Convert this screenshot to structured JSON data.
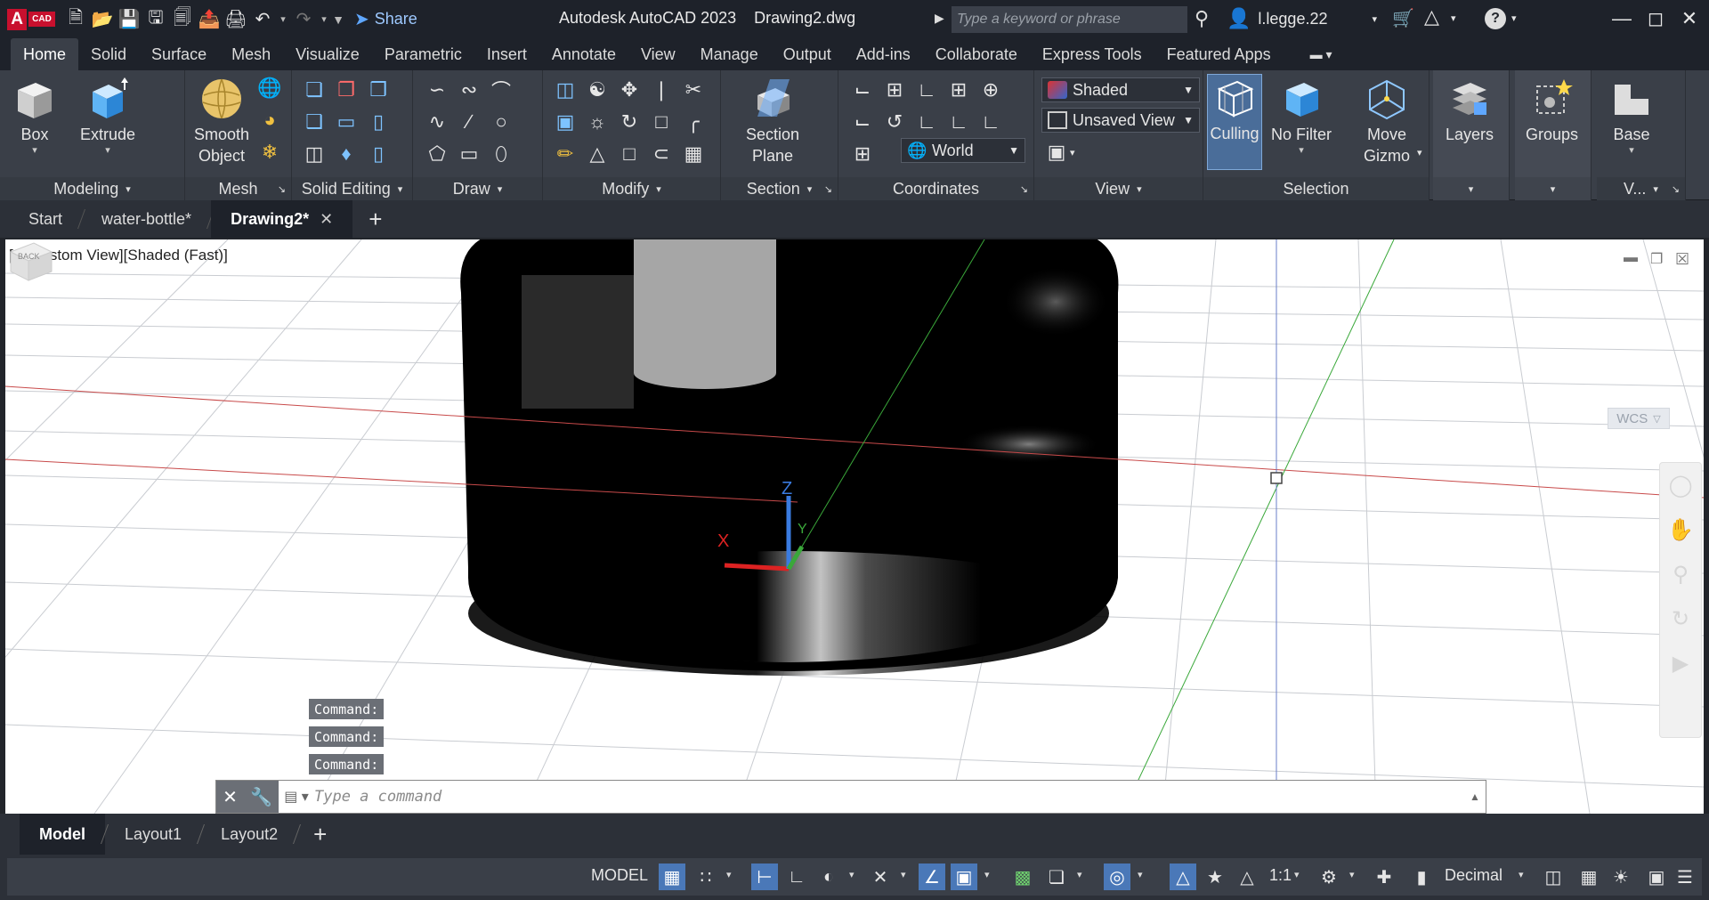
{
  "titlebar": {
    "app_badge": "A",
    "app_badge_sub": "CAD",
    "share_label": "Share",
    "title": "Autodesk AutoCAD 2023    Drawing2.dwg",
    "search_placeholder": "Type a keyword or phrase",
    "user_name": "l.legge.22"
  },
  "ribbon_tabs": [
    {
      "label": "Home",
      "active": true
    },
    {
      "label": "Solid"
    },
    {
      "label": "Surface"
    },
    {
      "label": "Mesh"
    },
    {
      "label": "Visualize"
    },
    {
      "label": "Parametric"
    },
    {
      "label": "Insert"
    },
    {
      "label": "Annotate"
    },
    {
      "label": "View"
    },
    {
      "label": "Manage"
    },
    {
      "label": "Output"
    },
    {
      "label": "Add-ins"
    },
    {
      "label": "Collaborate"
    },
    {
      "label": "Express Tools"
    },
    {
      "label": "Featured Apps"
    }
  ],
  "ribbon": {
    "modeling": {
      "title": "Modeling",
      "box": "Box",
      "extrude": "Extrude"
    },
    "mesh": {
      "title": "Mesh",
      "smooth_object_1": "Smooth",
      "smooth_object_2": "Object"
    },
    "solid_editing": {
      "title": "Solid Editing"
    },
    "draw": {
      "title": "Draw"
    },
    "modify": {
      "title": "Modify"
    },
    "section": {
      "title": "Section",
      "section_plane_1": "Section",
      "section_plane_2": "Plane"
    },
    "coordinates": {
      "title": "Coordinates",
      "ucs_value": "World"
    },
    "view": {
      "title": "View",
      "visual_style": "Shaded",
      "named_view": "Unsaved View"
    },
    "selection": {
      "title": "Selection",
      "culling": "Culling",
      "no_filter": "No Filter",
      "move_gizmo_1": "Move",
      "move_gizmo_2": "Gizmo"
    },
    "layers": {
      "label": "Layers"
    },
    "groups": {
      "label": "Groups"
    },
    "base": {
      "label": "Base",
      "title": "V..."
    }
  },
  "file_tabs": [
    {
      "label": "Start"
    },
    {
      "label": "water-bottle*"
    },
    {
      "label": "Drawing2*",
      "active": true
    }
  ],
  "viewport": {
    "label": "[−][Custom View][Shaded (Fast)]",
    "viewcube_face": "BACK",
    "wcs_label": "WCS",
    "axis_x": "X",
    "axis_y": "Y",
    "axis_z": "Z"
  },
  "command": {
    "history": [
      "Command:",
      "Command:",
      "Command:"
    ],
    "placeholder": "Type a command"
  },
  "layout_tabs": [
    {
      "label": "Model",
      "active": true
    },
    {
      "label": "Layout1"
    },
    {
      "label": "Layout2"
    }
  ],
  "statusbar": {
    "model": "MODEL",
    "scale": "1:1",
    "units": "Decimal"
  },
  "colors": {
    "accent": "#4a78b8",
    "brand_red": "#c8102e",
    "ribbon_bg": "#3a3f48",
    "title_bg": "#1e222a"
  }
}
